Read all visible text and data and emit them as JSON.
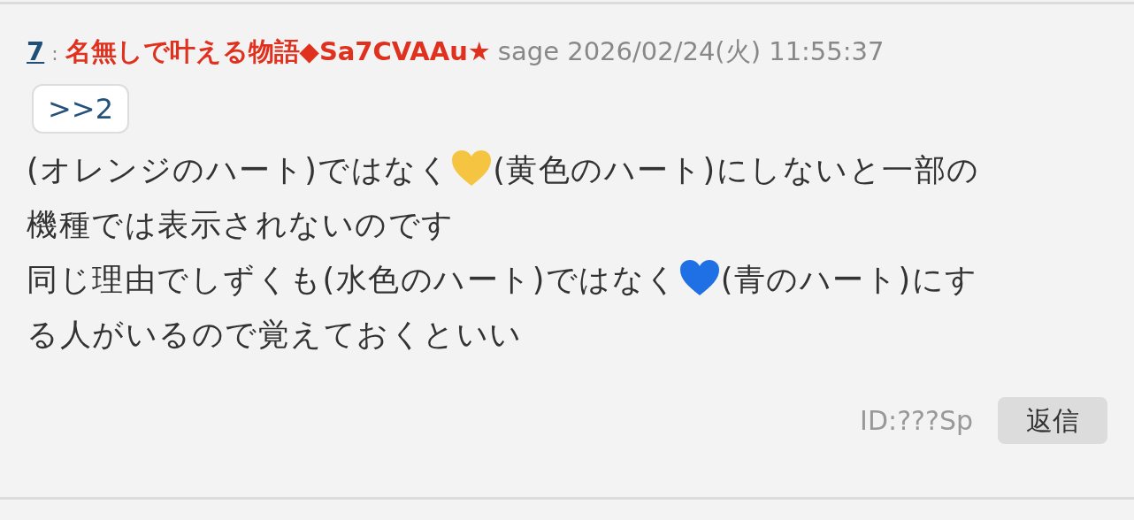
{
  "post": {
    "number": "7",
    "separator": ":",
    "author": "名無しで叶える物語◆Sa7CVAAu★",
    "mail": "sage",
    "date": "2026/02/24(火) 11:55:37",
    "anchor": ">>2",
    "body": [
      [
        {
          "kind": "text",
          "text": "(オレンジのハート)ではなく"
        },
        {
          "kind": "heart",
          "color": "#f5c542"
        },
        {
          "kind": "text",
          "text": "(黄色のハート)にしないと一部の"
        }
      ],
      [
        {
          "kind": "text",
          "text": "機種では表示されないのです"
        }
      ],
      [
        {
          "kind": "text",
          "text": "同じ理由でしずくも(水色のハート)ではなく"
        },
        {
          "kind": "heart",
          "color": "#1f6fe5"
        },
        {
          "kind": "text",
          "text": "(青のハート)にす"
        }
      ],
      [
        {
          "kind": "text",
          "text": "る人がいるので覚えておくといい"
        }
      ]
    ],
    "id": "ID:???Sp",
    "reply_button": "返信"
  }
}
